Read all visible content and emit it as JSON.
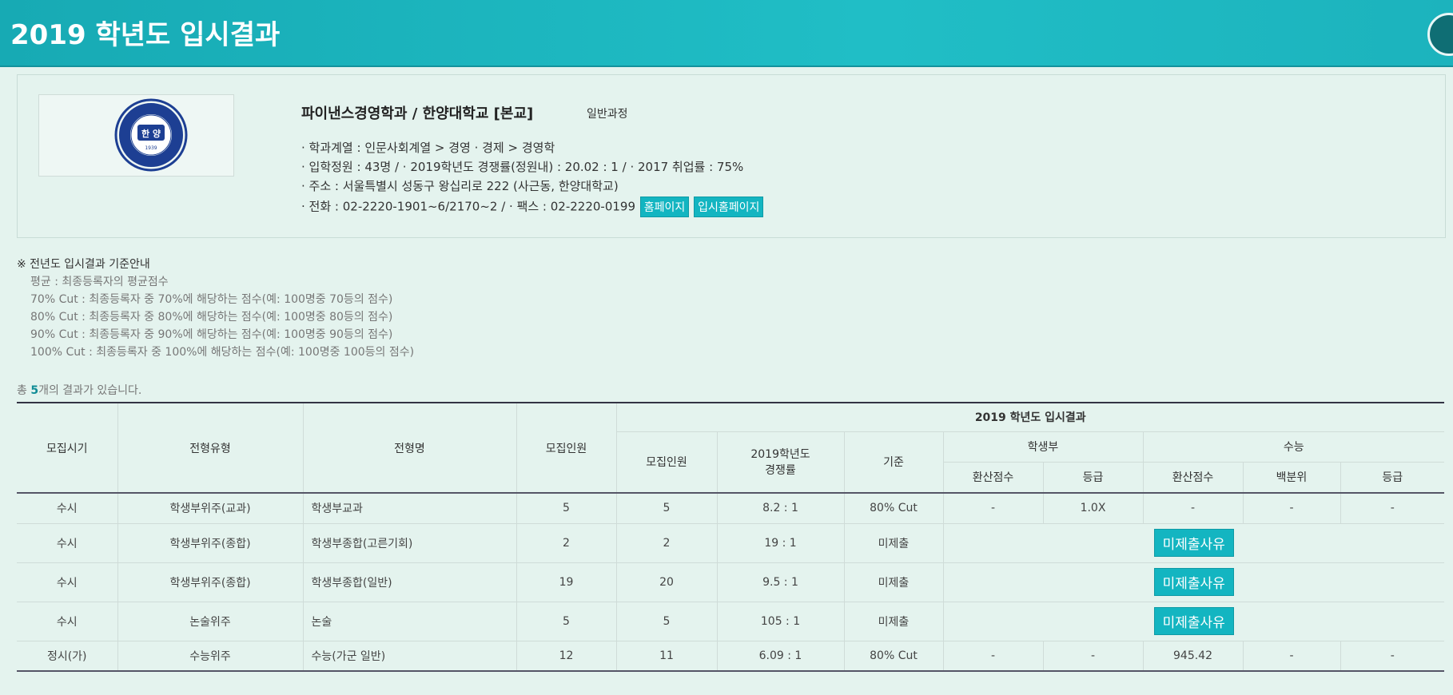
{
  "page_title": "2019 학년도 입시결과",
  "school": {
    "name": "파이낸스경영학과 / 한양대학교 [본교]",
    "course": "일반과정",
    "logo_text": "한 양",
    "logo_ring_text": "HANYANG UNIVERSITY",
    "logo_year": "1939",
    "line1": "· 학과계열 : 인문사회계열   > 경영 · 경제   > 경영학",
    "line2": "· 입학정원 : 43명 /   · 2019학년도 경쟁률(정원내) : 20.02 : 1 /   · 2017 취업률 : 75%",
    "line3": "· 주소 : 서울특별시 성동구 왕십리로 222 (사근동, 한양대학교)",
    "line4": "· 전화 : 02-2220-1901~6/2170~2 /   · 팩스 : 02-2220-0199",
    "homepage_btn": "홈페이지",
    "admission_homepage_btn": "입시홈페이지"
  },
  "notice": {
    "heading": "※ 전년도 입시결과 기준안내",
    "lines": [
      "평균 : 최종등록자의 평균점수",
      "70% Cut : 최종등록자 중 70%에 해당하는 점수(예: 100명중 70등의 점수)",
      "80% Cut : 최종등록자 중 80%에 해당하는 점수(예: 100명중 80등의 점수)",
      "90% Cut : 최종등록자 중 90%에 해당하는 점수(예: 100명중 90등의 점수)",
      "100% Cut : 최종등록자 중 100%에 해당하는 점수(예: 100명중 100등의 점수)"
    ]
  },
  "count": {
    "prefix": "총 ",
    "number": "5",
    "suffix": "개의 결과가 있습니다."
  },
  "table": {
    "headers": {
      "period": "모집시기",
      "type": "전형유형",
      "name": "전형명",
      "quota": "모집인원",
      "result_group": "2019 학년도 입시결과",
      "r_quota": "모집인원",
      "r_comp": "2019학년도\n경쟁률",
      "r_basis": "기준",
      "hs_group": "학생부",
      "hs_score": "환산점수",
      "hs_grade": "등급",
      "sn_group": "수능",
      "sn_score": "환산점수",
      "sn_pct": "백분위",
      "sn_grade": "등급"
    },
    "missing_btn": "미제출사유",
    "rows": [
      {
        "period": "수시",
        "type": "학생부위주(교과)",
        "name": "학생부교과",
        "quota": "5",
        "r_quota": "5",
        "comp": "8.2 : 1",
        "basis": "80% Cut",
        "hs_score": "-",
        "hs_grade": "1.0X",
        "sn_score": "-",
        "sn_pct": "-",
        "sn_grade": "-",
        "missing": false
      },
      {
        "period": "수시",
        "type": "학생부위주(종합)",
        "name": "학생부종합(고른기회)",
        "quota": "2",
        "r_quota": "2",
        "comp": "19 : 1",
        "basis": "미제출",
        "missing": true
      },
      {
        "period": "수시",
        "type": "학생부위주(종합)",
        "name": "학생부종합(일반)",
        "quota": "19",
        "r_quota": "20",
        "comp": "9.5 : 1",
        "basis": "미제출",
        "missing": true
      },
      {
        "period": "수시",
        "type": "논술위주",
        "name": "논술",
        "quota": "5",
        "r_quota": "5",
        "comp": "105 : 1",
        "basis": "미제출",
        "missing": true
      },
      {
        "period": "정시(가)",
        "type": "수능위주",
        "name": "수능(가군 일반)",
        "quota": "12",
        "r_quota": "11",
        "comp": "6.09 : 1",
        "basis": "80% Cut",
        "hs_score": "-",
        "hs_grade": "-",
        "sn_score": "945.42",
        "sn_pct": "-",
        "sn_grade": "-",
        "missing": false
      }
    ]
  }
}
